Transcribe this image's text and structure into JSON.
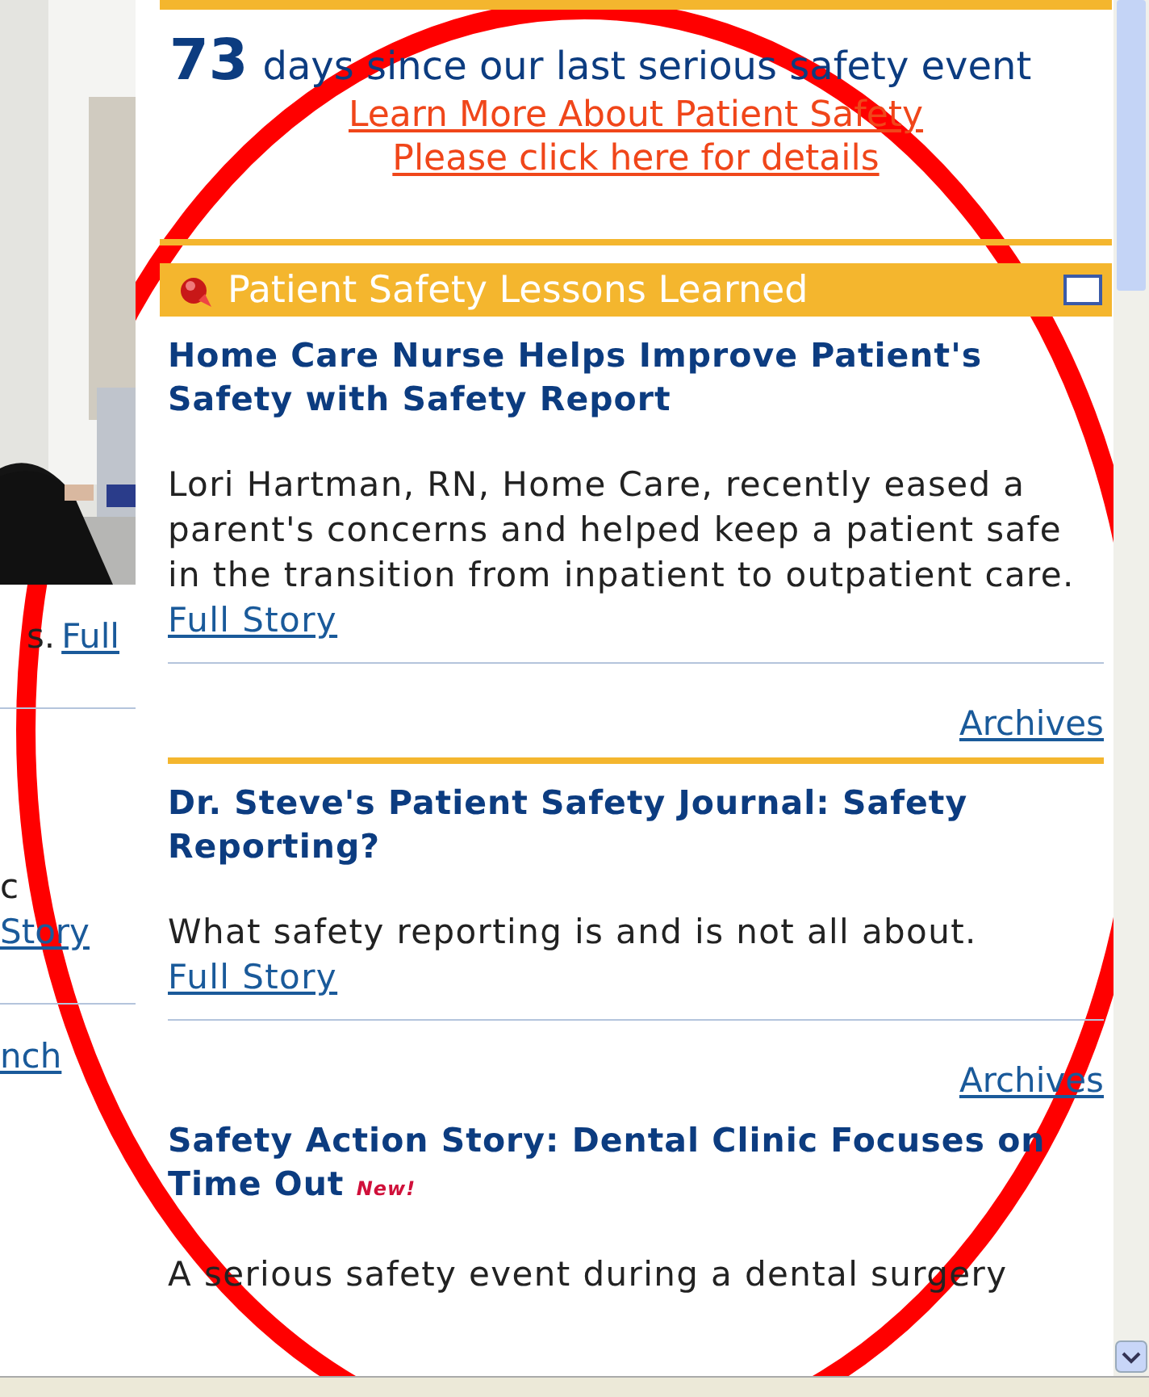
{
  "left_column": {
    "blocks": [
      {
        "items": [
          {
            "kind": "text",
            "text": "s."
          },
          {
            "kind": "link",
            "text": "Full"
          }
        ]
      },
      {
        "items": [
          {
            "kind": "text",
            "text": "c"
          },
          {
            "kind": "link",
            "text": "Story"
          }
        ]
      },
      {
        "items": [
          {
            "kind": "link",
            "text": "nch"
          }
        ]
      }
    ]
  },
  "counter": {
    "number": "73",
    "caption": "days since our last serious safety event"
  },
  "links": [
    "Learn More About Patient Safety",
    "Please click here for details"
  ],
  "section": {
    "title": "Patient Safety Lessons Learned"
  },
  "articles": [
    {
      "title": "Home Care Nurse Helps Improve Patient's Safety with Safety Report",
      "summary": "Lori Hartman, RN, Home Care, recently eased a parent's concerns and helped keep a patient safe in the transition from inpatient to outpatient care.",
      "link": "Full Story",
      "archives": "Archives",
      "rule_below": true
    },
    {
      "title": "Dr. Steve's Patient Safety Journal: Safety Reporting?",
      "summary": "What safety reporting is and is not all about.",
      "link": "Full Story",
      "archives": "Archives",
      "rule_below": false
    },
    {
      "title": "Safety Action Story: Dental Clinic Focuses on Time Out",
      "badge": "New!",
      "summary": "A serious safety event during a dental surgery"
    }
  ],
  "annotation": {
    "kind": "ellipse"
  }
}
